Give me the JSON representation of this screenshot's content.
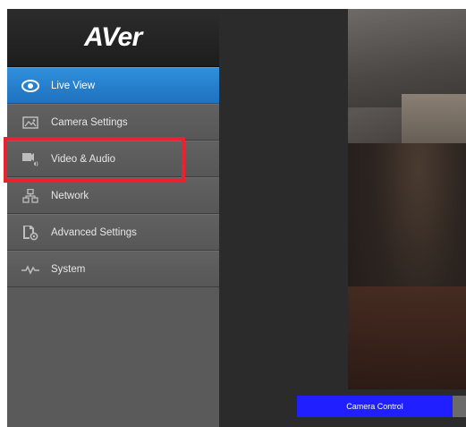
{
  "app": {
    "logo_text": "AVer"
  },
  "sidebar": {
    "items": [
      {
        "label": "Live View",
        "icon": "eye-icon",
        "active": true
      },
      {
        "label": "Camera Settings",
        "icon": "image-icon",
        "active": false
      },
      {
        "label": "Video & Audio",
        "icon": "video-audio-icon",
        "active": false
      },
      {
        "label": "Network",
        "icon": "network-icon",
        "active": false
      },
      {
        "label": "Advanced Settings",
        "icon": "advanced-settings-icon",
        "active": false
      },
      {
        "label": "System",
        "icon": "pulse-icon",
        "active": false
      }
    ]
  },
  "main": {
    "control_label": "Camera Control"
  },
  "colors": {
    "active_nav": "#1f72bf",
    "highlight_box": "#e8232f",
    "control_bar": "#1f1fff"
  }
}
